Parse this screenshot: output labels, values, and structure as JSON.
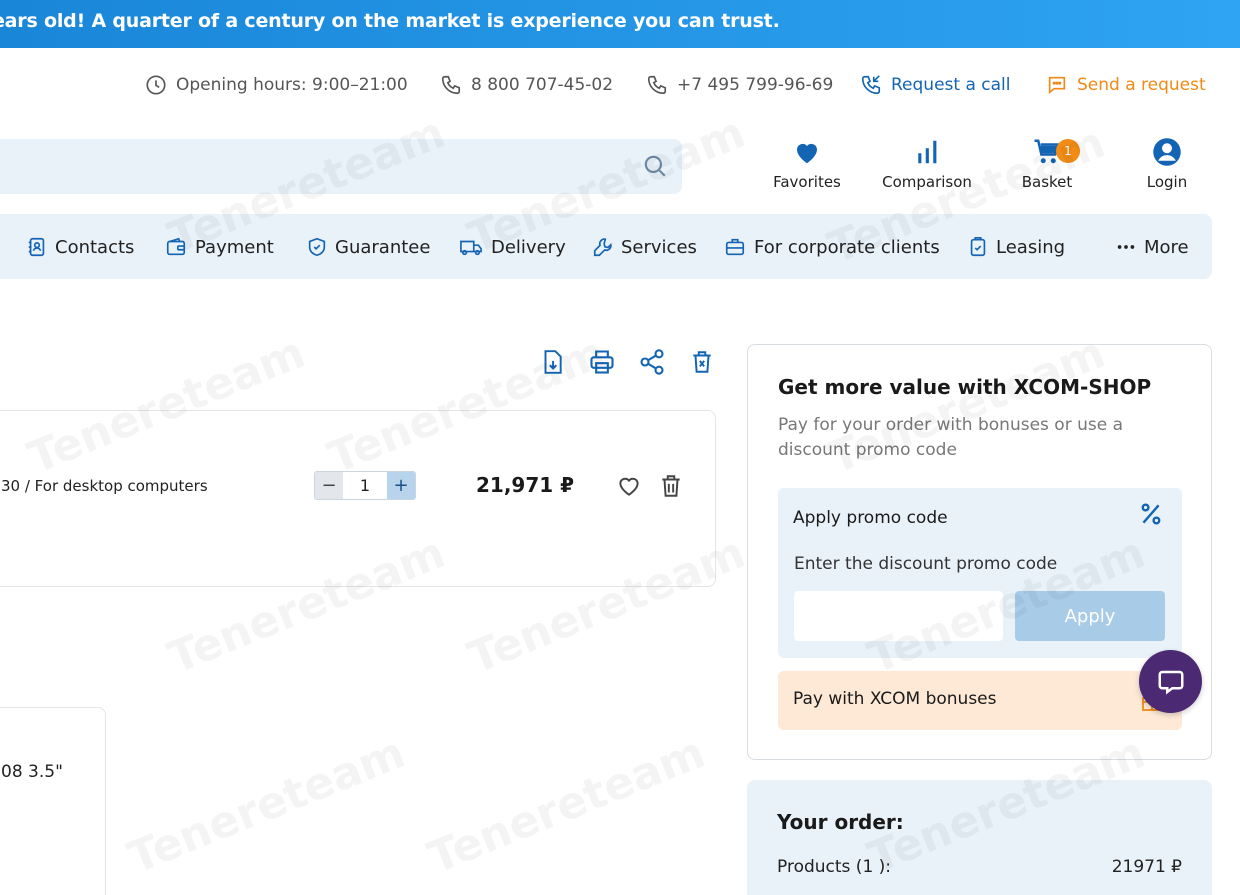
{
  "banner": {
    "text": "ears old! A quarter of a century on the market is experience you can trust."
  },
  "contacts": {
    "hours": "Opening hours: 9:00–21:00",
    "phone1": "8 800 707-45-02",
    "phone2": "+7 495 799-96-69",
    "request_call": "Request a call",
    "send_request": "Send a request"
  },
  "search": {
    "placeholder": ""
  },
  "header_icons": {
    "favorites": "Favorites",
    "comparison": "Comparison",
    "basket": "Basket",
    "basket_count": "1",
    "login": "Login"
  },
  "nav": {
    "contacts": "Contacts",
    "payment": "Payment",
    "guarantee": "Guarantee",
    "delivery": "Delivery",
    "services": "Services",
    "corporate": "For corporate clients",
    "leasing": "Leasing",
    "more": "More"
  },
  "cart_item": {
    "name": "30 / For desktop computers",
    "quantity": "1",
    "minus": "−",
    "plus": "+",
    "price": "21,971 ₽"
  },
  "cart_item2": {
    "name": "08 3.5\""
  },
  "side": {
    "title": "Get more value with XCOM-SHOP",
    "subtitle": "Pay for your order with bonuses or use a discount promo code",
    "promo_title": "Apply promo code",
    "promo_label": "Enter the discount promo code",
    "promo_value": "",
    "apply": "Apply",
    "bonus": "Pay with XCOM bonuses"
  },
  "order": {
    "title": "Your order:",
    "products_label": "Products (1 ):",
    "products_total": "21971 ₽"
  },
  "watermark": "Tenereteam",
  "colors": {
    "accent": "#1464b4",
    "orange": "#f08a14",
    "panel": "#e9f1f9",
    "bonus_bg": "#fde9d6",
    "chat": "#4b2a73"
  }
}
